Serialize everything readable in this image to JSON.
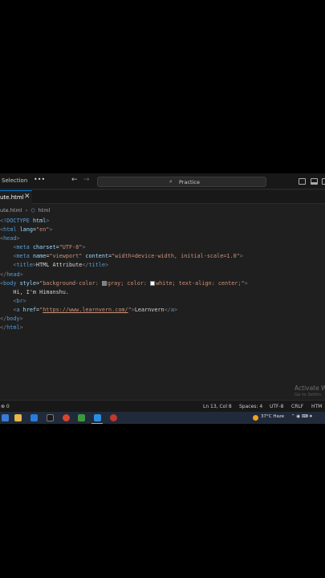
{
  "titlebar": {
    "menu_selection": "Selection",
    "more": "•••",
    "back": "←",
    "forward": "→",
    "search_text": "Practice"
  },
  "tabs": [
    {
      "label": "ute.html",
      "close": "✕"
    }
  ],
  "breadcrumb": {
    "file": "ute.html",
    "separator": "›",
    "node": "html"
  },
  "code_lines": [
    "<!DOCTYPE html>",
    "<html lang=\"en\">",
    "<head>",
    "    <meta charset=\"UTF-8\">",
    "    <meta name=\"viewport\" content=\"width=device-width, initial-scale=1.0\">",
    "    <title>HTML Attribute</title>",
    "</head>",
    "<body style=\"background-color: gray; color: white; text-align: center;\">",
    "    Hi, I'm Himanshu.",
    "    <br>",
    "    <a href=\"https://www.learnvern.com/\">Learnvern</a>",
    "</body>",
    "</html>"
  ],
  "watermark": {
    "line1": "Activate W",
    "line2": "Go to Settin"
  },
  "statusbar": {
    "problems": "⊗ 0",
    "cursor": "Ln 13, Col 8",
    "spaces": "Spaces: 4",
    "encoding": "UTF-8",
    "eol": "CRLF",
    "language": "HTM"
  },
  "taskbar": {
    "weather": "37°C Haze",
    "tray": "⌃ ◉ ⌨ 🕪"
  },
  "colors": {
    "editor_bg": "#1f1f1f",
    "titlebar_bg": "#181818",
    "accent": "#0078d4",
    "taskbar_bg": "#202a3a"
  }
}
